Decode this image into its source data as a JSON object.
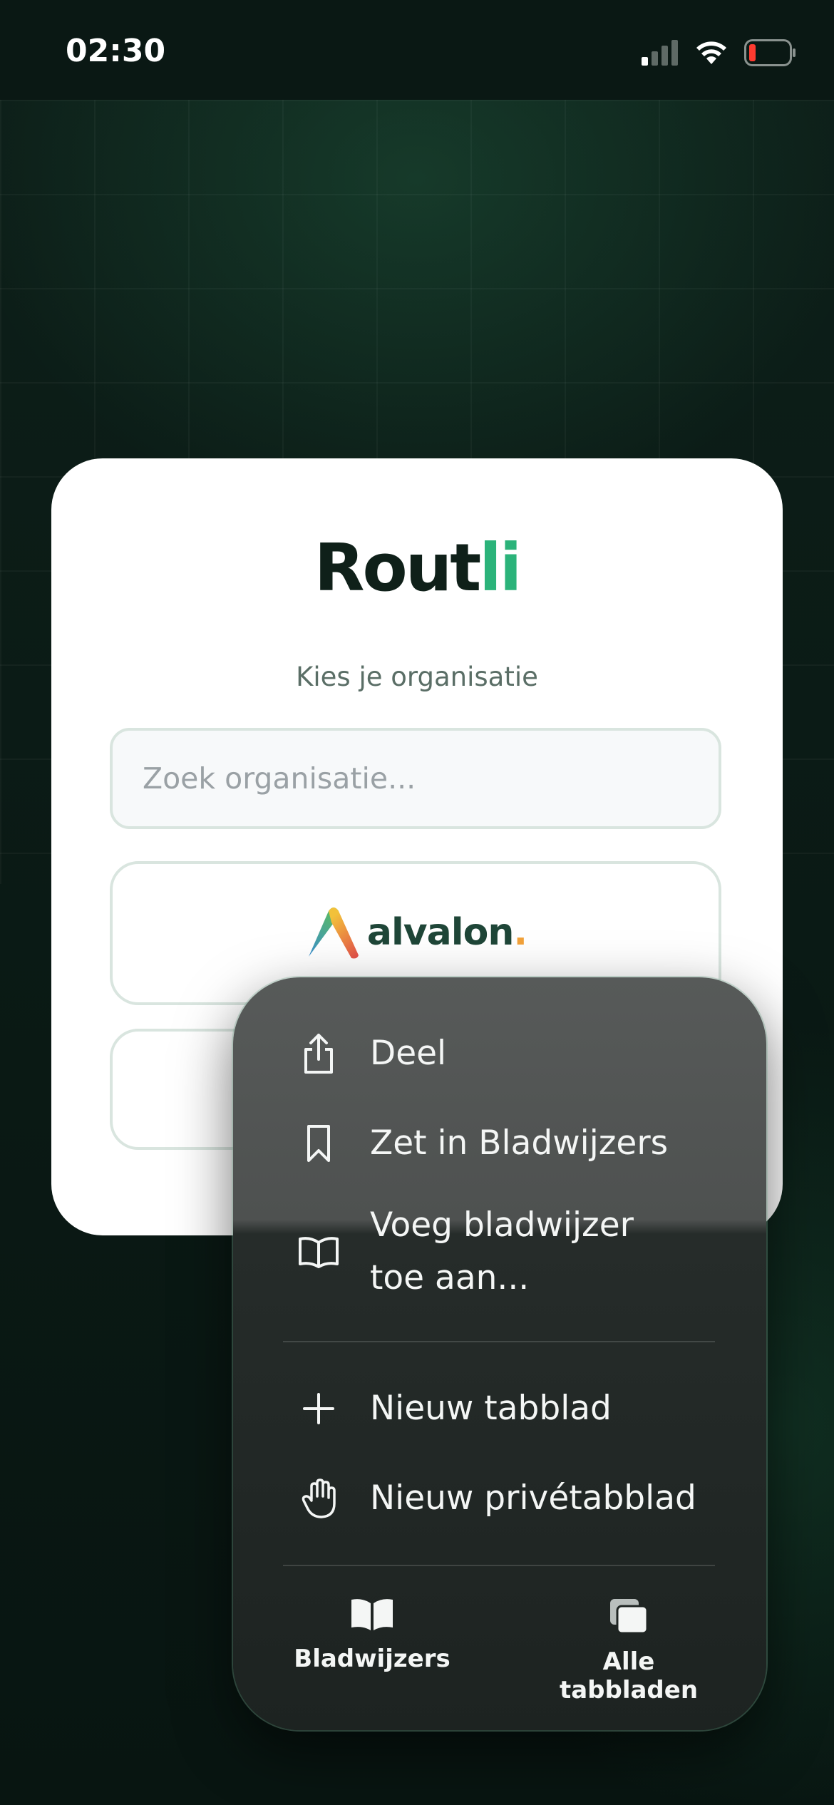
{
  "status_bar": {
    "time": "02:30"
  },
  "card": {
    "logo_main": "Rout",
    "logo_accent": "li",
    "subtitle": "Kies je organisatie",
    "search_placeholder": "Zoek organisatie...",
    "organizations": [
      {
        "name": "alvalon",
        "dot": "."
      }
    ]
  },
  "context_menu": {
    "items": [
      {
        "label": "Deel",
        "icon": "share-icon"
      },
      {
        "label": "Zet in Bladwijzers",
        "icon": "bookmark-icon"
      },
      {
        "label": "Voeg bladwijzer toe aan...",
        "icon": "open-book-icon"
      },
      {
        "label": "Nieuw tabblad",
        "icon": "plus-icon"
      },
      {
        "label": "Nieuw privétabblad",
        "icon": "hand-icon"
      }
    ],
    "bottom": [
      {
        "label": "Bladwijzers",
        "icon": "book-icon"
      },
      {
        "label": "Alle tabbladen",
        "icon": "tabs-icon"
      }
    ]
  },
  "colors": {
    "accent": "#2bb37a",
    "dark": "#0f2019",
    "battery_low": "#ff3b30"
  }
}
